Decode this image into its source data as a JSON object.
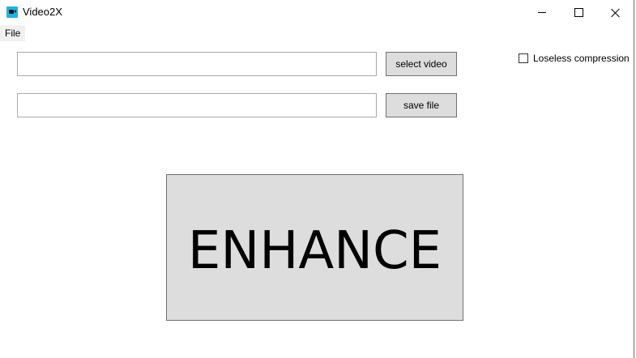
{
  "window": {
    "title": "Video2X",
    "app_icon": "video-camera-icon",
    "accent_color": "#1fb5e0",
    "controls": {
      "minimize": "minimize-icon",
      "maximize": "maximize-icon",
      "close": "close-icon"
    }
  },
  "menu": {
    "items": [
      {
        "label": "File"
      }
    ]
  },
  "inputs": {
    "video_path": {
      "value": "",
      "placeholder": ""
    },
    "save_path": {
      "value": "",
      "placeholder": ""
    }
  },
  "buttons": {
    "select_video": "select video",
    "save_file": "save file",
    "enhance": "ENHANCE"
  },
  "options": {
    "lossless": {
      "label": "Loseless compression",
      "checked": false
    }
  }
}
